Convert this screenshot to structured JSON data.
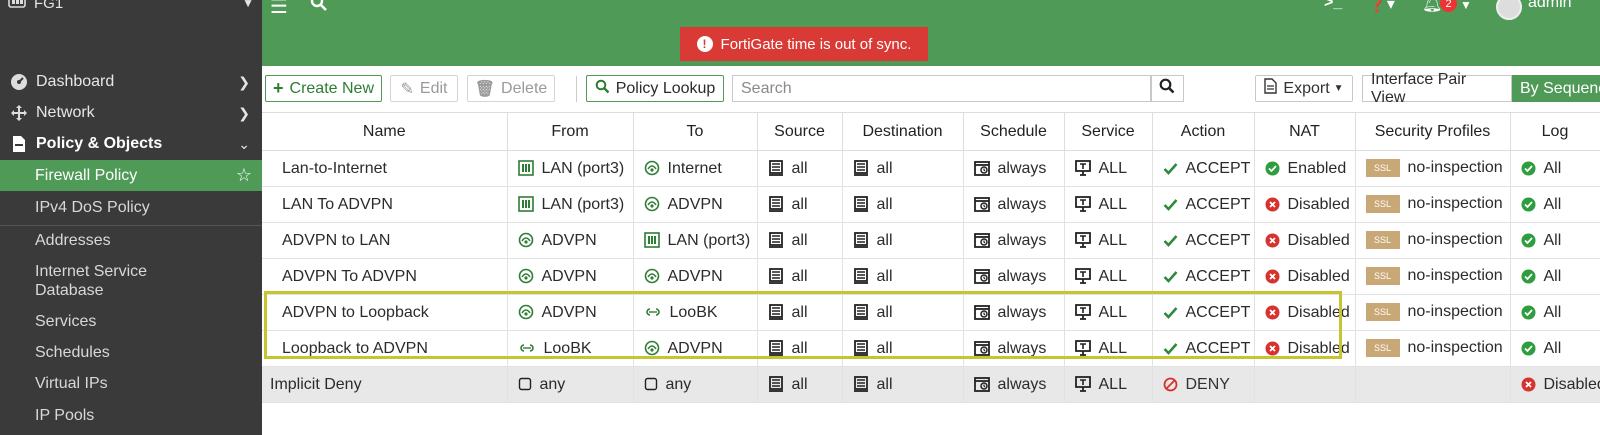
{
  "sidebar": {
    "device": "FG1",
    "items": [
      {
        "label": "Dashboard",
        "icon": "dashboard-icon"
      },
      {
        "label": "Network",
        "icon": "network-icon"
      },
      {
        "label": "Policy & Objects",
        "icon": "policy-icon"
      }
    ],
    "subitems": [
      {
        "label": "Firewall Policy"
      },
      {
        "label": "IPv4 DoS Policy"
      },
      {
        "label": "Addresses"
      },
      {
        "label": "Internet Service Database"
      },
      {
        "label": "Services"
      },
      {
        "label": "Schedules"
      },
      {
        "label": "Virtual IPs"
      },
      {
        "label": "IP Pools"
      }
    ]
  },
  "topbar": {
    "alert": "FortiGate time is out of sync.",
    "notification_count": "2",
    "user": "admin"
  },
  "toolbar": {
    "create_new": "Create New",
    "edit": "Edit",
    "delete": "Delete",
    "policy_lookup": "Policy Lookup",
    "search_placeholder": "Search",
    "export": "Export",
    "interface_pair_view": "Interface Pair View",
    "by_sequence": "By Sequence"
  },
  "colors": {
    "brand_green": "#4e9a56",
    "sidebar_bg": "#3a3a3a",
    "alert_red": "#d93a36",
    "highlight": "#c7c431"
  },
  "table": {
    "columns": [
      "Name",
      "From",
      "To",
      "Source",
      "Destination",
      "Schedule",
      "Service",
      "Action",
      "NAT",
      "Security Profiles",
      "Log"
    ],
    "rows": [
      {
        "name": "Lan-to-Internet",
        "from": "LAN (port3)",
        "from_icon": "port-icon",
        "to": "Internet",
        "to_icon": "wan-icon",
        "source": "all",
        "destination": "all",
        "schedule": "always",
        "service": "ALL",
        "action": "ACCEPT",
        "nat": "Enabled",
        "nat_state": "enabled",
        "profile": "no-inspection",
        "log": "All"
      },
      {
        "name": "LAN To ADVPN",
        "from": "LAN (port3)",
        "from_icon": "port-icon",
        "to": "ADVPN",
        "to_icon": "wan-icon",
        "source": "all",
        "destination": "all",
        "schedule": "always",
        "service": "ALL",
        "action": "ACCEPT",
        "nat": "Disabled",
        "nat_state": "disabled",
        "profile": "no-inspection",
        "log": "All"
      },
      {
        "name": "ADVPN to LAN",
        "from": "ADVPN",
        "from_icon": "wan-icon",
        "to": "LAN (port3)",
        "to_icon": "port-icon",
        "source": "all",
        "destination": "all",
        "schedule": "always",
        "service": "ALL",
        "action": "ACCEPT",
        "nat": "Disabled",
        "nat_state": "disabled",
        "profile": "no-inspection",
        "log": "All"
      },
      {
        "name": "ADVPN To ADVPN",
        "from": "ADVPN",
        "from_icon": "wan-icon",
        "to": "ADVPN",
        "to_icon": "wan-icon",
        "source": "all",
        "destination": "all",
        "schedule": "always",
        "service": "ALL",
        "action": "ACCEPT",
        "nat": "Disabled",
        "nat_state": "disabled",
        "profile": "no-inspection",
        "log": "All"
      },
      {
        "name": "ADVPN to Loopback",
        "from": "ADVPN",
        "from_icon": "wan-icon",
        "to": "LooBK",
        "to_icon": "loopback-icon",
        "source": "all",
        "destination": "all",
        "schedule": "always",
        "service": "ALL",
        "action": "ACCEPT",
        "nat": "Disabled",
        "nat_state": "disabled",
        "profile": "no-inspection",
        "log": "All"
      },
      {
        "name": "Loopback to ADVPN",
        "from": "LooBK",
        "from_icon": "loopback-icon",
        "to": "ADVPN",
        "to_icon": "wan-icon",
        "source": "all",
        "destination": "all",
        "schedule": "always",
        "service": "ALL",
        "action": "ACCEPT",
        "nat": "Disabled",
        "nat_state": "disabled",
        "profile": "no-inspection",
        "log": "All"
      }
    ],
    "implicit": {
      "name": "Implicit Deny",
      "from": "any",
      "to": "any",
      "source": "all",
      "destination": "all",
      "schedule": "always",
      "service": "ALL",
      "action": "DENY",
      "log": "Disabled"
    },
    "ssl_badge": "SSL"
  }
}
